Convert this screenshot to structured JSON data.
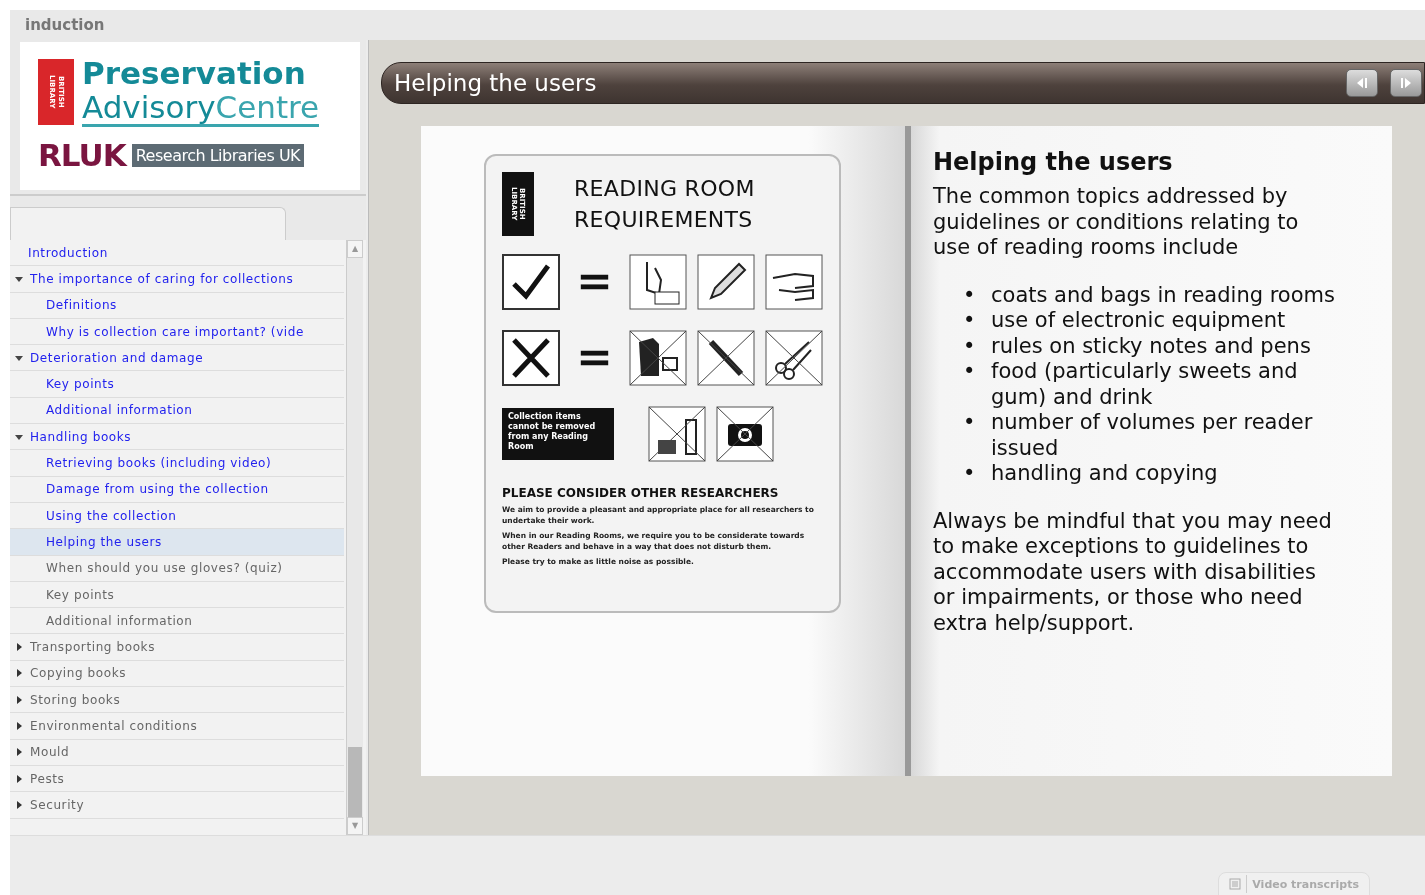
{
  "app_title": "induction",
  "logo": {
    "badge_lines": [
      "LIBRARY",
      "BRITISH"
    ],
    "name_line1": "Preservation",
    "name_line2_a": "Advisory",
    "name_line2_b": "Centre",
    "rluk": "RLUK",
    "rluk_full": "Research Libraries UK"
  },
  "nav": [
    {
      "label": "Introduction",
      "kind": "page",
      "visited": true,
      "selected": false
    },
    {
      "label": "The importance of caring for collections",
      "kind": "section",
      "visited": true,
      "selected": false,
      "expanded": true,
      "children": [
        {
          "label": "Definitions",
          "kind": "page",
          "visited": true,
          "selected": false
        },
        {
          "label": "Why is collection care important? (vide",
          "kind": "page",
          "visited": true,
          "selected": false
        }
      ]
    },
    {
      "label": "Deterioration and damage",
      "kind": "section",
      "visited": true,
      "selected": false,
      "expanded": true,
      "children": [
        {
          "label": "Key points",
          "kind": "page",
          "visited": true,
          "selected": false
        },
        {
          "label": "Additional information",
          "kind": "page",
          "visited": true,
          "selected": false
        }
      ]
    },
    {
      "label": "Handling books",
      "kind": "section",
      "visited": true,
      "selected": false,
      "expanded": true,
      "children": [
        {
          "label": "Retrieving books (including video)",
          "kind": "page",
          "visited": true,
          "selected": false
        },
        {
          "label": "Damage from using the collection",
          "kind": "page",
          "visited": true,
          "selected": false
        },
        {
          "label": "Using the collection",
          "kind": "page",
          "visited": true,
          "selected": false
        },
        {
          "label": "Helping the users",
          "kind": "page",
          "visited": true,
          "selected": true
        },
        {
          "label": "When should you use gloves? (quiz)",
          "kind": "page",
          "visited": false,
          "selected": false
        },
        {
          "label": "Key points",
          "kind": "page",
          "visited": false,
          "selected": false
        },
        {
          "label": "Additional information",
          "kind": "page",
          "visited": false,
          "selected": false
        }
      ]
    },
    {
      "label": "Transporting books",
      "kind": "section",
      "visited": false,
      "selected": false,
      "expanded": false
    },
    {
      "label": "Copying books",
      "kind": "section",
      "visited": false,
      "selected": false,
      "expanded": false
    },
    {
      "label": "Storing books",
      "kind": "section",
      "visited": false,
      "selected": false,
      "expanded": false
    },
    {
      "label": "Environmental conditions",
      "kind": "section",
      "visited": false,
      "selected": false,
      "expanded": false
    },
    {
      "label": "Mould",
      "kind": "section",
      "visited": false,
      "selected": false,
      "expanded": false
    },
    {
      "label": "Pests",
      "kind": "section",
      "visited": false,
      "selected": false,
      "expanded": false
    },
    {
      "label": "Security",
      "kind": "section",
      "visited": false,
      "selected": false,
      "expanded": false
    }
  ],
  "scroll_up": "▲",
  "scroll_down": "▼",
  "page_title": "Helping the users",
  "sign": {
    "badge_lines": [
      "LIBRARY",
      "BRITISH"
    ],
    "title_lines": [
      "READING ROOM",
      "REQUIREMENTS"
    ],
    "notice": "Collection items cannot be removed from any Reading Room",
    "heading": "PLEASE CONSIDER OTHER RESEARCHERS",
    "paragraphs": [
      "We aim to provide a pleasant and appropriate place for all researchers to undertake their work.",
      "When in our Reading Rooms, we require you to be considerate towards other Readers and behave in a way that does not disturb them.",
      "Please try to make as little noise as possible."
    ]
  },
  "article": {
    "heading": "Helping the users",
    "intro": "The common topics addressed by guidelines or conditions relating to use of reading rooms include",
    "bullet_marker": "•",
    "bullets": [
      "coats and bags in reading rooms",
      "use of electronic equipment",
      "rules on sticky notes and pens",
      "food (particularly sweets and gum) and drink",
      "number of volumes per reader issued",
      "handling and copying"
    ],
    "closing": "Always be mindful that you may need to make exceptions to guidelines to accommodate users with disabilities or impairments, or those who need extra help/support."
  },
  "footer": {
    "button": "Video transcripts"
  }
}
